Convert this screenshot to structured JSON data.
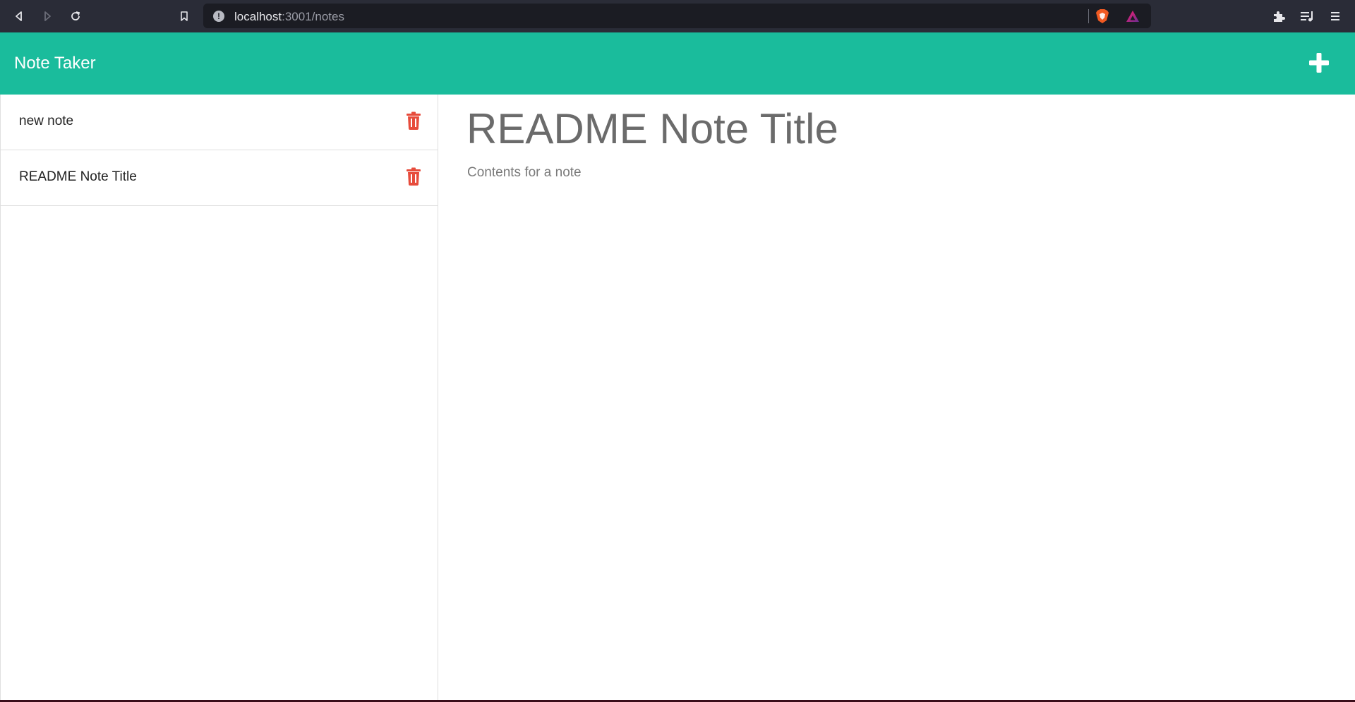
{
  "browser": {
    "url_host": "localhost",
    "url_rest": ":3001/notes",
    "icons": [
      "back-icon",
      "forward-icon",
      "reload-icon",
      "bookmark-icon",
      "info-icon",
      "brave-shield-icon",
      "brave-rewards-icon",
      "extensions-icon",
      "media-queue-icon",
      "menu-icon"
    ]
  },
  "header": {
    "title": "Note Taker",
    "add_icon": "plus-icon"
  },
  "sidebar": {
    "notes": [
      {
        "label": "new note"
      },
      {
        "label": "README Note Title"
      }
    ],
    "delete_icon": "trash-icon"
  },
  "main": {
    "note_title": "README Note Title",
    "note_text": "Contents for a note"
  },
  "colors": {
    "header_bg": "#1abc9c",
    "delete_red": "#e74c3c",
    "browser_bg": "#2a2c37"
  }
}
